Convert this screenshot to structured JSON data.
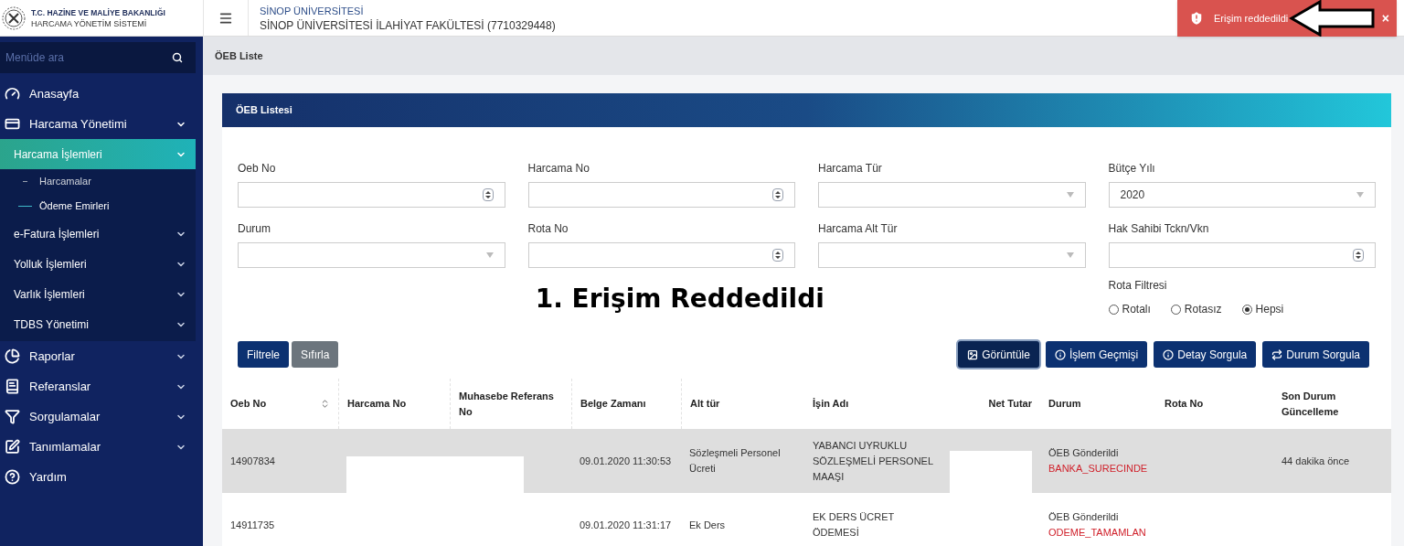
{
  "brand": {
    "line1": "T.C. HAZİNE VE MALİYE BAKANLIĞI",
    "line2": "HARCAMA YÖNETİM SİSTEMİ"
  },
  "header": {
    "org": "SİNOP ÜNİVERSİTESİ",
    "unit": "SİNOP ÜNİVERSİTESİ İLAHİYAT FAKÜLTESİ (7710329448)"
  },
  "toast": {
    "message": "Erişim reddedildi",
    "close": "×"
  },
  "sidebar": {
    "search_placeholder": "Menüde ara",
    "items": [
      {
        "label": "Anasayfa",
        "selected": false
      },
      {
        "label": "Harcama Yönetimi",
        "expanded": true,
        "selected": false,
        "children": [
          {
            "label": "Harcama İşlemleri",
            "expanded": true,
            "selected": true,
            "children": [
              {
                "label": "Harcamalar",
                "selected": false
              },
              {
                "label": "Ödeme Emirleri",
                "selected": true
              }
            ]
          },
          {
            "label": "e-Fatura İşlemleri",
            "expanded": false,
            "selected": false
          },
          {
            "label": "Yolluk İşlemleri",
            "expanded": false,
            "selected": false
          },
          {
            "label": "Varlık İşlemleri",
            "expanded": false,
            "selected": false
          },
          {
            "label": "TDBS Yönetimi",
            "expanded": false,
            "selected": false
          }
        ]
      },
      {
        "label": "Raporlar",
        "expanded": false,
        "selected": false
      },
      {
        "label": "Referanslar",
        "expanded": false,
        "selected": false
      },
      {
        "label": "Sorgulamalar",
        "expanded": false,
        "selected": false
      },
      {
        "label": "Tanımlamalar",
        "expanded": false,
        "selected": false
      },
      {
        "label": "Yardım",
        "selected": false
      }
    ]
  },
  "breadcrumb": "ÖEB Liste",
  "card_title": "ÖEB Listesi",
  "filters": [
    {
      "label": "Oeb No",
      "kind": "number"
    },
    {
      "label": "Harcama No",
      "kind": "number"
    },
    {
      "label": "Harcama Tür",
      "kind": "select"
    },
    {
      "label": "Bütçe Yılı",
      "kind": "select",
      "value": "2020"
    },
    {
      "label": "Durum",
      "kind": "select"
    },
    {
      "label": "Rota No",
      "kind": "number"
    },
    {
      "label": "Harcama Alt Tür",
      "kind": "select"
    },
    {
      "label": "Hak Sahibi Tckn/Vkn",
      "kind": "number"
    }
  ],
  "annotation": "1. Erişim Reddedildi",
  "route_filter": {
    "label": "Rota Filtresi",
    "options": [
      {
        "label": "Rotalı",
        "selected": false
      },
      {
        "label": "Rotasız",
        "selected": false
      },
      {
        "label": "Hepsi",
        "selected": true
      }
    ]
  },
  "left_buttons": [
    {
      "label": "Filtrele",
      "kind": "primary"
    },
    {
      "label": "Sıfırla",
      "kind": "secondary"
    }
  ],
  "right_buttons": [
    {
      "label": "Görüntüle",
      "focused": true
    },
    {
      "label": "İşlem Geçmişi",
      "focused": false
    },
    {
      "label": "Detay Sorgula",
      "focused": false
    },
    {
      "label": "Durum Sorgula",
      "focused": false
    }
  ],
  "table": {
    "columns": [
      "Oeb No",
      "Harcama No",
      "Muhasebe Referans No",
      "Belge Zamanı",
      "Alt tür",
      "İşin Adı",
      "Net Tutar",
      "Durum",
      "Rota No",
      "Son Durum Güncelleme"
    ],
    "rows": [
      {
        "selected": true,
        "redacted": true,
        "oeb_no": "14907834",
        "belge_zamani": "09.01.2020 11:30:53",
        "alt_tur": "Sözleşmeli Personel Ücreti",
        "isin_adi": "YABANCI UYRUKLU SÖZLEŞMELİ PERSONEL MAAŞI",
        "durum": "ÖEB Gönderildi",
        "durum_kodu": "BANKA_SURECINDE",
        "son_durum": "44 dakika önce"
      },
      {
        "selected": false,
        "oeb_no": "14911735",
        "belge_zamani": "09.01.2020 11:31:17",
        "alt_tur": "Ek Ders",
        "isin_adi": "EK DERS ÜCRET ÖDEMESİ",
        "durum": "ÖEB Gönderildi",
        "durum_kodu": "ODEME_TAMAMLAN"
      }
    ]
  }
}
